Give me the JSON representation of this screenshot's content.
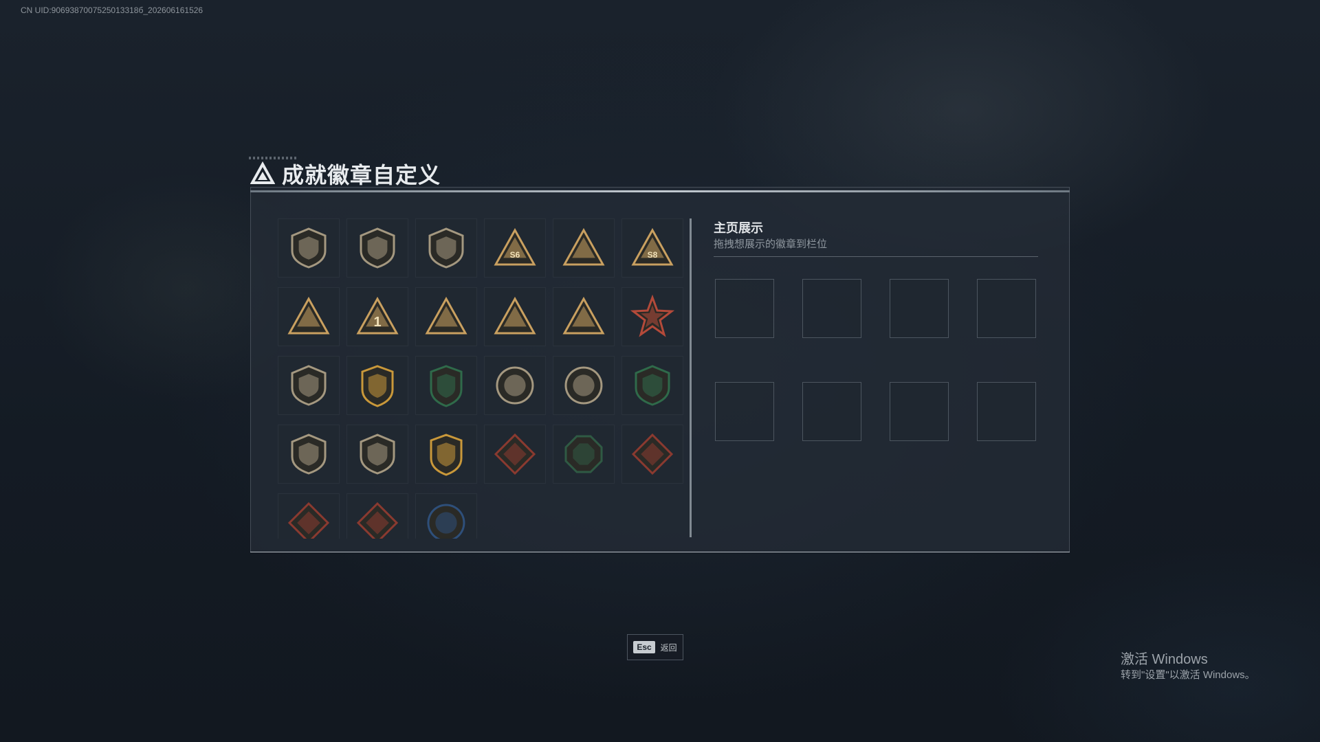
{
  "uid_text": "CN UID:9069387007525013318б_202606161526",
  "dialog": {
    "title": "成就徽章自定义"
  },
  "badges": [
    {
      "name": "shield-triangle",
      "color": "#a49880",
      "shape": "shield"
    },
    {
      "name": "helicopter",
      "color": "#a49880",
      "shape": "shield"
    },
    {
      "name": "diamond-emblem",
      "color": "#a49880",
      "shape": "shield"
    },
    {
      "name": "s6-triangle",
      "color": "#c9a060",
      "shape": "triangle",
      "text": "S6"
    },
    {
      "name": "tower-triangle",
      "color": "#c9a060",
      "shape": "triangle"
    },
    {
      "name": "s8-triangle",
      "color": "#c9a060",
      "shape": "triangle",
      "text": "S8"
    },
    {
      "name": "boat-triangle",
      "color": "#c9a060",
      "shape": "triangle"
    },
    {
      "name": "number-one-triangle",
      "color": "#c9a060",
      "shape": "triangle",
      "text": "1"
    },
    {
      "name": "helmet-triangle",
      "color": "#c9a060",
      "shape": "triangle"
    },
    {
      "name": "soldier-triangle",
      "color": "#c9a060",
      "shape": "triangle"
    },
    {
      "name": "rocket-triangle",
      "color": "#c9a060",
      "shape": "triangle"
    },
    {
      "name": "star-medal",
      "color": "#b44a3a",
      "shape": "star"
    },
    {
      "name": "wing-shield",
      "color": "#a49880",
      "shape": "shield"
    },
    {
      "name": "gold-crest",
      "color": "#c9983a",
      "shape": "crest"
    },
    {
      "name": "green-crest",
      "color": "#2f6a4a",
      "shape": "crest"
    },
    {
      "name": "skull-circle",
      "color": "#a49880",
      "shape": "circle"
    },
    {
      "name": "eye-circle",
      "color": "#a49880",
      "shape": "circle"
    },
    {
      "name": "green-target-shield",
      "color": "#2f6a4a",
      "shape": "shield"
    },
    {
      "name": "rifle-shield",
      "color": "#a49880",
      "shape": "shield"
    },
    {
      "name": "sniper-shield",
      "color": "#a49880",
      "shape": "shield"
    },
    {
      "name": "gold-wings-crest",
      "color": "#c9983a",
      "shape": "crest"
    },
    {
      "name": "wolf-diamond",
      "color": "#8a3a30",
      "shape": "diamond"
    },
    {
      "name": "eagle-octagon",
      "color": "#2f5a44",
      "shape": "octagon"
    },
    {
      "name": "dragon-diamond",
      "color": "#8a3a30",
      "shape": "diamond"
    },
    {
      "name": "dragon-diamond-2",
      "color": "#8a3a30",
      "shape": "diamond"
    },
    {
      "name": "fist-diamond",
      "color": "#8a3a30",
      "shape": "diamond"
    },
    {
      "name": "wolf-circle-blue",
      "color": "#2e4f7a",
      "shape": "circle"
    }
  ],
  "showcase": {
    "title": "主页展示",
    "subtitle": "拖拽想展示的徽章到栏位",
    "slot_count": 8
  },
  "footer": {
    "esc_key": "Esc",
    "esc_label": "返回"
  },
  "watermark": {
    "title": "激活 Windows",
    "subtitle": "转到\"设置\"以激活 Windows。"
  }
}
